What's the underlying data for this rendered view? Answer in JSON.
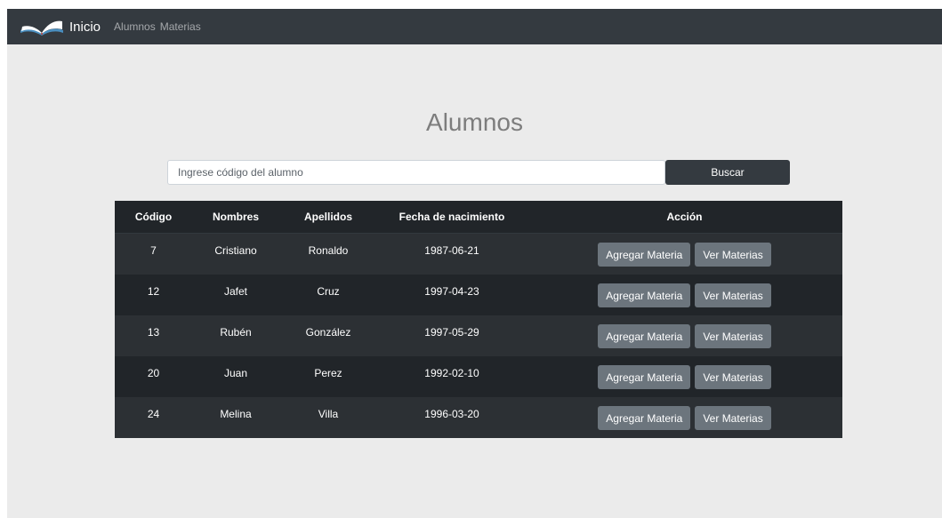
{
  "nav": {
    "brand": "Inicio",
    "links": [
      "Alumnos",
      "Materias"
    ]
  },
  "page": {
    "title": "Alumnos"
  },
  "search": {
    "placeholder": "Ingrese código del alumno",
    "value": "",
    "button": "Buscar"
  },
  "table": {
    "headers": [
      "Código",
      "Nombres",
      "Apellidos",
      "Fecha de nacimiento",
      "Acción"
    ],
    "rows": [
      {
        "codigo": "7",
        "nombres": "Cristiano",
        "apellidos": "Ronaldo",
        "fecha": "1987-06-21"
      },
      {
        "codigo": "12",
        "nombres": "Jafet",
        "apellidos": "Cruz",
        "fecha": "1997-04-23"
      },
      {
        "codigo": "13",
        "nombres": "Rubén",
        "apellidos": "González",
        "fecha": "1997-05-29"
      },
      {
        "codigo": "20",
        "nombres": "Juan",
        "apellidos": "Perez",
        "fecha": "1992-02-10"
      },
      {
        "codigo": "24",
        "nombres": "Melina",
        "apellidos": "Villa",
        "fecha": "1996-03-20"
      }
    ],
    "actions": {
      "add": "Agregar Materia",
      "view": "Ver Materias"
    }
  },
  "colors": {
    "navbar": "#343a40",
    "background": "#ebebeb",
    "table_dark": "#212529",
    "table_stripe": "#2c3034",
    "button_secondary": "#6c757d"
  },
  "icons": {
    "brand": "open-book-icon"
  }
}
